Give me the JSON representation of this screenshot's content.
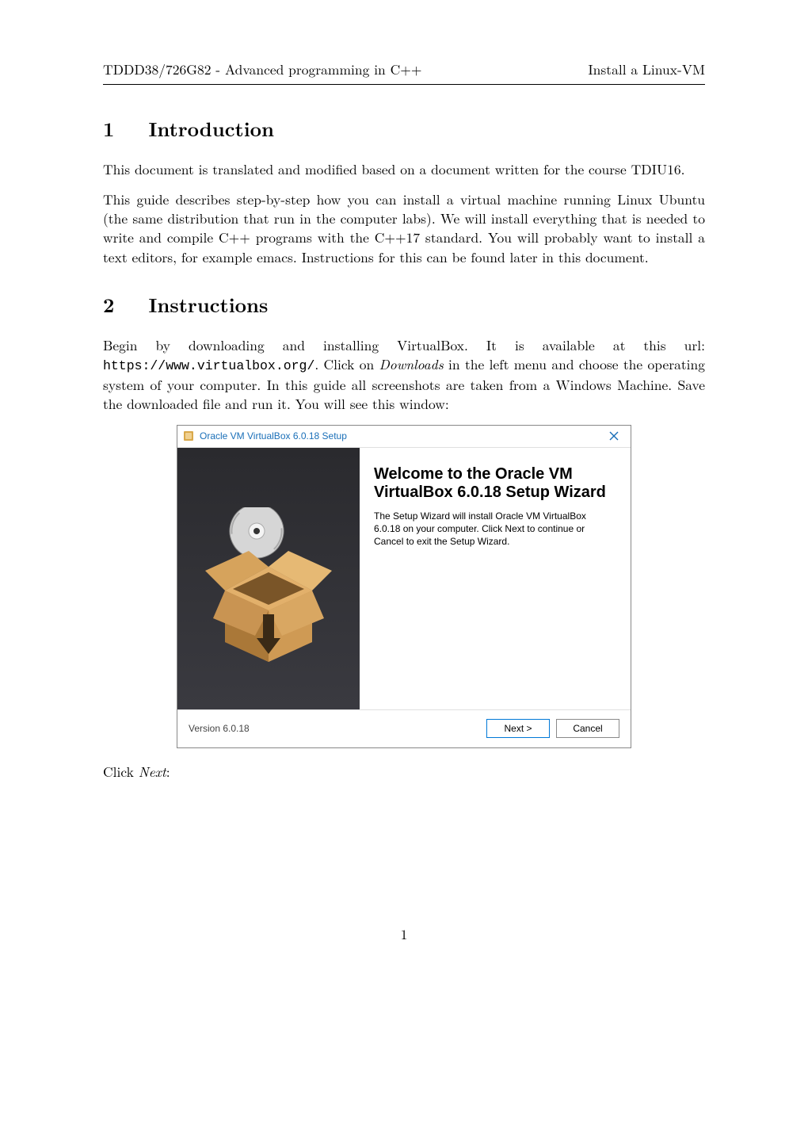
{
  "header": {
    "left": "TDDD38/726G82 - Advanced programming in C++",
    "right": "Install a Linux-VM"
  },
  "section1": {
    "number": "1",
    "title": "Introduction",
    "p1": "This document is translated and modified based on a document written for the course TDIU16.",
    "p2": "This guide describes step-by-step how you can install a virtual machine running Linux Ubuntu (the same distribution that run in the computer labs). We will install everything that is needed to write and compile C++ programs with the C++17 standard. You will probably want to install a text editors, for example emacs. Instructions for this can be found later in this document."
  },
  "section2": {
    "number": "2",
    "title": "Instructions",
    "p1_a": "Begin by downloading and installing VirtualBox. It is available at this url: ",
    "url": "https://www.virtualbox.org/",
    "p1_b": ". Click on ",
    "downloads": "Downloads",
    "p1_c": " in the left menu and choose the operating system of your computer. In this guide all screenshots are taken from a Windows Machine. Save the downloaded file and run it. You will see this window:"
  },
  "dialog": {
    "title": "Oracle VM VirtualBox 6.0.18 Setup",
    "heading": "Welcome to the Oracle VM VirtualBox 6.0.18 Setup Wizard",
    "body": "The Setup Wizard will install Oracle VM VirtualBox 6.0.18 on your computer. Click Next to continue or Cancel to exit the Setup Wizard.",
    "version": "Version 6.0.18",
    "next": "Next >",
    "cancel": "Cancel"
  },
  "after_dialog": {
    "click": "Click ",
    "next": "Next",
    "colon": ":"
  },
  "page_number": "1"
}
